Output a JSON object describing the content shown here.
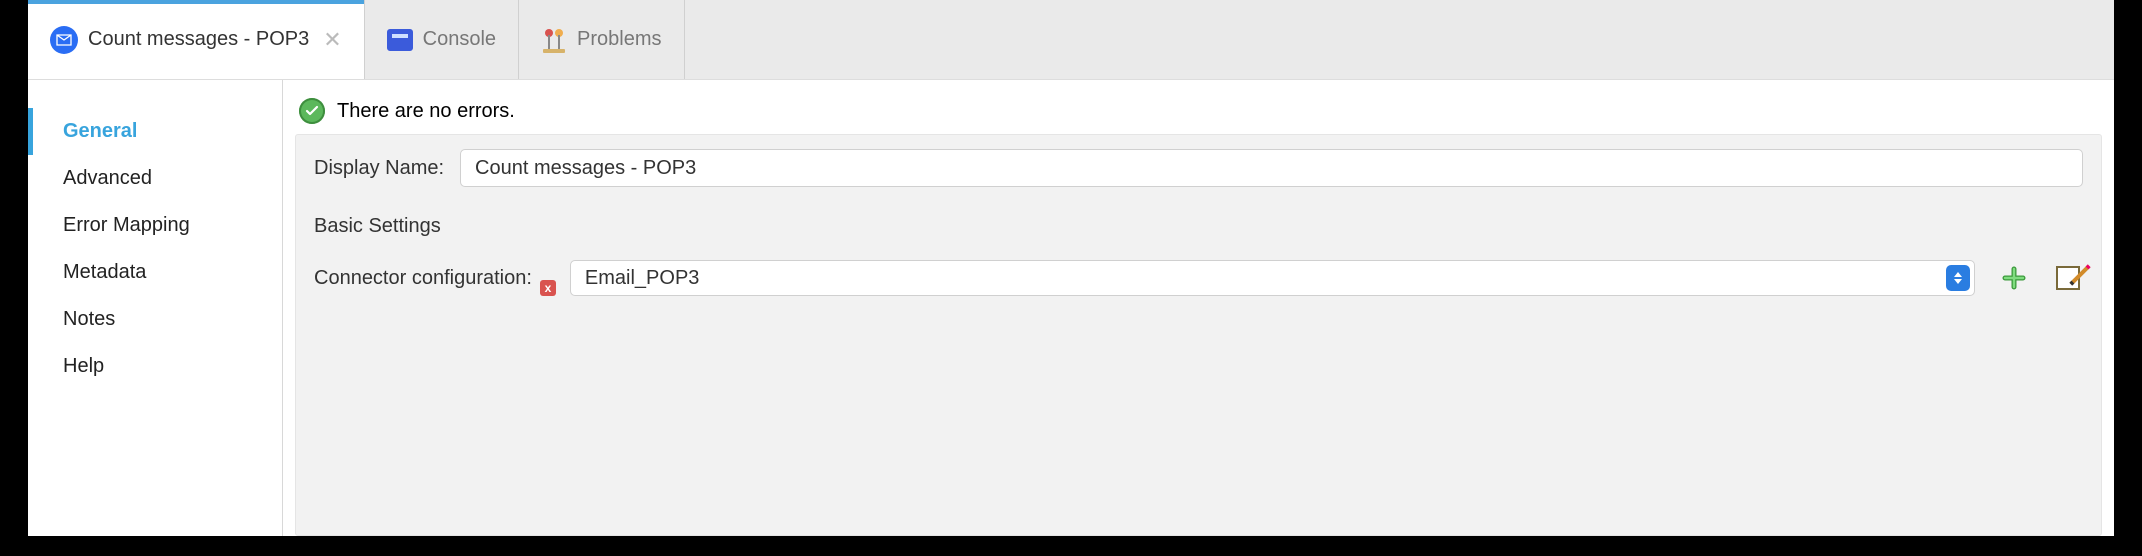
{
  "tabs": {
    "active": {
      "label": "Count messages - POP3"
    },
    "console": {
      "label": "Console"
    },
    "problems": {
      "label": "Problems"
    }
  },
  "sidebar": {
    "items": [
      {
        "label": "General"
      },
      {
        "label": "Advanced"
      },
      {
        "label": "Error Mapping"
      },
      {
        "label": "Metadata"
      },
      {
        "label": "Notes"
      },
      {
        "label": "Help"
      }
    ]
  },
  "status": {
    "message": "There are no errors."
  },
  "form": {
    "display_name_label": "Display Name:",
    "display_name_value": "Count messages - POP3",
    "basic_settings_label": "Basic Settings",
    "connector_config_label": "Connector configuration:",
    "connector_config_value": "Email_POP3",
    "error_badge": "x"
  }
}
